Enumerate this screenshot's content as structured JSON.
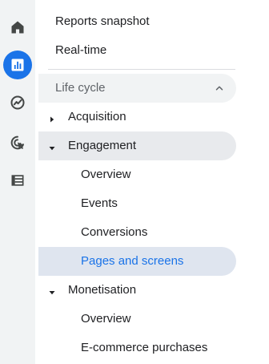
{
  "rail": {
    "icons": [
      {
        "name": "home-icon"
      },
      {
        "name": "reports-icon",
        "active": true
      },
      {
        "name": "explore-icon"
      },
      {
        "name": "advertising-icon"
      },
      {
        "name": "configure-icon"
      }
    ]
  },
  "nav": {
    "reports_snapshot": "Reports snapshot",
    "realtime": "Real-time",
    "section": "Life cycle",
    "acquisition": "Acquisition",
    "engagement": "Engagement",
    "engagement_items": [
      "Overview",
      "Events",
      "Conversions",
      "Pages and screens"
    ],
    "monetisation": "Monetisation",
    "monetisation_items": [
      "Overview",
      "E-commerce purchases"
    ]
  },
  "colors": {
    "accent": "#1a73e8",
    "rail_bg": "#f1f3f4",
    "selected_bg": "#dfe5ef",
    "hover_bg": "#e8eaed"
  }
}
